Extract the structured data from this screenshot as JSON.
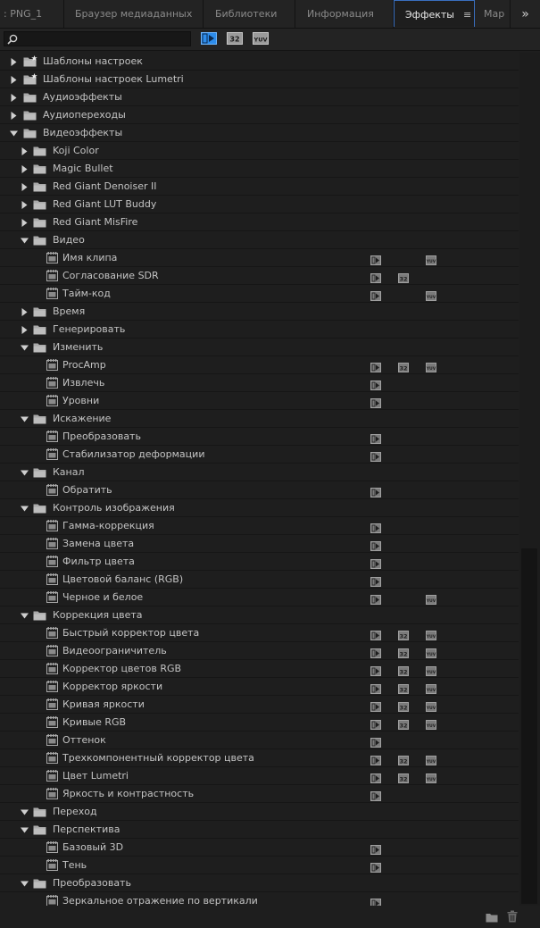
{
  "tabs": [
    {
      "label": ": PNG_1",
      "active": false
    },
    {
      "label": "Браузер медиаданных",
      "active": false
    },
    {
      "label": "Библиотеки",
      "active": false
    },
    {
      "label": "Информация",
      "active": false
    },
    {
      "label": "Эффекты",
      "active": true
    },
    {
      "label": "Мар",
      "active": false
    }
  ],
  "tab_menu_icon": "≡",
  "overflow_icon": "»",
  "search": {
    "value": "",
    "placeholder": ""
  },
  "filter_buttons": [
    "accelerated-effects-icon",
    "32-bit-icon",
    "yuv-icon"
  ],
  "badge_text": {
    "b32": "32",
    "yuv": "YUV"
  },
  "tree": [
    {
      "label": "Шаблоны настроек",
      "level": 0,
      "type": "preset",
      "expanded": false
    },
    {
      "label": "Шаблоны настроек Lumetri",
      "level": 0,
      "type": "preset",
      "expanded": false
    },
    {
      "label": "Аудиоэффекты",
      "level": 0,
      "type": "folder",
      "expanded": false
    },
    {
      "label": "Аудиопереходы",
      "level": 0,
      "type": "folder",
      "expanded": false
    },
    {
      "label": "Видеоэффекты",
      "level": 0,
      "type": "folder",
      "expanded": true
    },
    {
      "label": "Koji Color",
      "level": 1,
      "type": "folder",
      "expanded": false
    },
    {
      "label": "Magic Bullet",
      "level": 1,
      "type": "folder",
      "expanded": false
    },
    {
      "label": "Red Giant Denoiser II",
      "level": 1,
      "type": "folder",
      "expanded": false
    },
    {
      "label": "Red Giant LUT Buddy",
      "level": 1,
      "type": "folder",
      "expanded": false
    },
    {
      "label": "Red Giant MisFire",
      "level": 1,
      "type": "folder",
      "expanded": false
    },
    {
      "label": "Видео",
      "level": 1,
      "type": "folder",
      "expanded": true
    },
    {
      "label": "Имя клипа",
      "level": 2,
      "type": "effect",
      "badges": [
        "acc",
        "yuv"
      ]
    },
    {
      "label": "Согласование SDR",
      "level": 2,
      "type": "effect",
      "badges": [
        "acc",
        "b32"
      ]
    },
    {
      "label": "Тайм-код",
      "level": 2,
      "type": "effect",
      "badges": [
        "acc",
        "yuv"
      ]
    },
    {
      "label": "Время",
      "level": 1,
      "type": "folder",
      "expanded": false
    },
    {
      "label": "Генерировать",
      "level": 1,
      "type": "folder",
      "expanded": false
    },
    {
      "label": "Изменить",
      "level": 1,
      "type": "folder",
      "expanded": true
    },
    {
      "label": "ProcAmp",
      "level": 2,
      "type": "effect",
      "badges": [
        "acc",
        "b32",
        "yuv"
      ]
    },
    {
      "label": "Извлечь",
      "level": 2,
      "type": "effect",
      "badges": [
        "acc"
      ]
    },
    {
      "label": "Уровни",
      "level": 2,
      "type": "effect",
      "badges": [
        "acc"
      ]
    },
    {
      "label": "Искажение",
      "level": 1,
      "type": "folder",
      "expanded": true
    },
    {
      "label": "Преобразовать",
      "level": 2,
      "type": "effect",
      "badges": [
        "acc"
      ]
    },
    {
      "label": "Стабилизатор деформации",
      "level": 2,
      "type": "effect",
      "badges": [
        "acc"
      ]
    },
    {
      "label": "Канал",
      "level": 1,
      "type": "folder",
      "expanded": true
    },
    {
      "label": "Обратить",
      "level": 2,
      "type": "effect",
      "badges": [
        "acc"
      ]
    },
    {
      "label": "Контроль изображения",
      "level": 1,
      "type": "folder",
      "expanded": true
    },
    {
      "label": "Гамма-коррекция",
      "level": 2,
      "type": "effect",
      "badges": [
        "acc"
      ]
    },
    {
      "label": "Замена цвета",
      "level": 2,
      "type": "effect",
      "badges": [
        "acc"
      ]
    },
    {
      "label": "Фильтр цвета",
      "level": 2,
      "type": "effect",
      "badges": [
        "acc"
      ]
    },
    {
      "label": "Цветовой баланс (RGB)",
      "level": 2,
      "type": "effect",
      "badges": [
        "acc"
      ]
    },
    {
      "label": "Черное и белое",
      "level": 2,
      "type": "effect",
      "badges": [
        "acc",
        "yuv"
      ]
    },
    {
      "label": "Коррекция цвета",
      "level": 1,
      "type": "folder",
      "expanded": true
    },
    {
      "label": "Быстрый корректор цвета",
      "level": 2,
      "type": "effect",
      "badges": [
        "acc",
        "b32",
        "yuv"
      ]
    },
    {
      "label": "Видеоограничитель",
      "level": 2,
      "type": "effect",
      "badges": [
        "acc",
        "b32",
        "yuv"
      ]
    },
    {
      "label": "Корректор цветов RGB",
      "level": 2,
      "type": "effect",
      "badges": [
        "acc",
        "b32",
        "yuv"
      ]
    },
    {
      "label": "Корректор яркости",
      "level": 2,
      "type": "effect",
      "badges": [
        "acc",
        "b32",
        "yuv"
      ]
    },
    {
      "label": "Кривая яркости",
      "level": 2,
      "type": "effect",
      "badges": [
        "acc",
        "b32",
        "yuv"
      ]
    },
    {
      "label": "Кривые RGB",
      "level": 2,
      "type": "effect",
      "badges": [
        "acc",
        "b32",
        "yuv"
      ]
    },
    {
      "label": "Оттенок",
      "level": 2,
      "type": "effect",
      "badges": [
        "acc"
      ]
    },
    {
      "label": "Трехкомпонентный корректор цвета",
      "level": 2,
      "type": "effect",
      "badges": [
        "acc",
        "b32",
        "yuv"
      ]
    },
    {
      "label": "Цвет Lumetri",
      "level": 2,
      "type": "effect",
      "badges": [
        "acc",
        "b32",
        "yuv"
      ]
    },
    {
      "label": "Яркость и контрастность",
      "level": 2,
      "type": "effect",
      "badges": [
        "acc"
      ]
    },
    {
      "label": "Переход",
      "level": 1,
      "type": "folder",
      "expanded": true
    },
    {
      "label": "Перспектива",
      "level": 1,
      "type": "folder",
      "expanded": true
    },
    {
      "label": "Базовый 3D",
      "level": 2,
      "type": "effect",
      "badges": [
        "acc"
      ]
    },
    {
      "label": "Тень",
      "level": 2,
      "type": "effect",
      "badges": [
        "acc"
      ]
    },
    {
      "label": "Преобразовать",
      "level": 1,
      "type": "folder",
      "expanded": true
    },
    {
      "label": "Зеркальное отражение по вертикали",
      "level": 2,
      "type": "effect",
      "badges": [
        "acc"
      ]
    }
  ],
  "footer": {
    "new_bin_icon": "folder-icon",
    "delete_icon": "trash-icon"
  },
  "colors": {
    "accent": "#3a6fbf",
    "panel": "#1e1e1e",
    "toggle_active": "#2d8ceb"
  }
}
